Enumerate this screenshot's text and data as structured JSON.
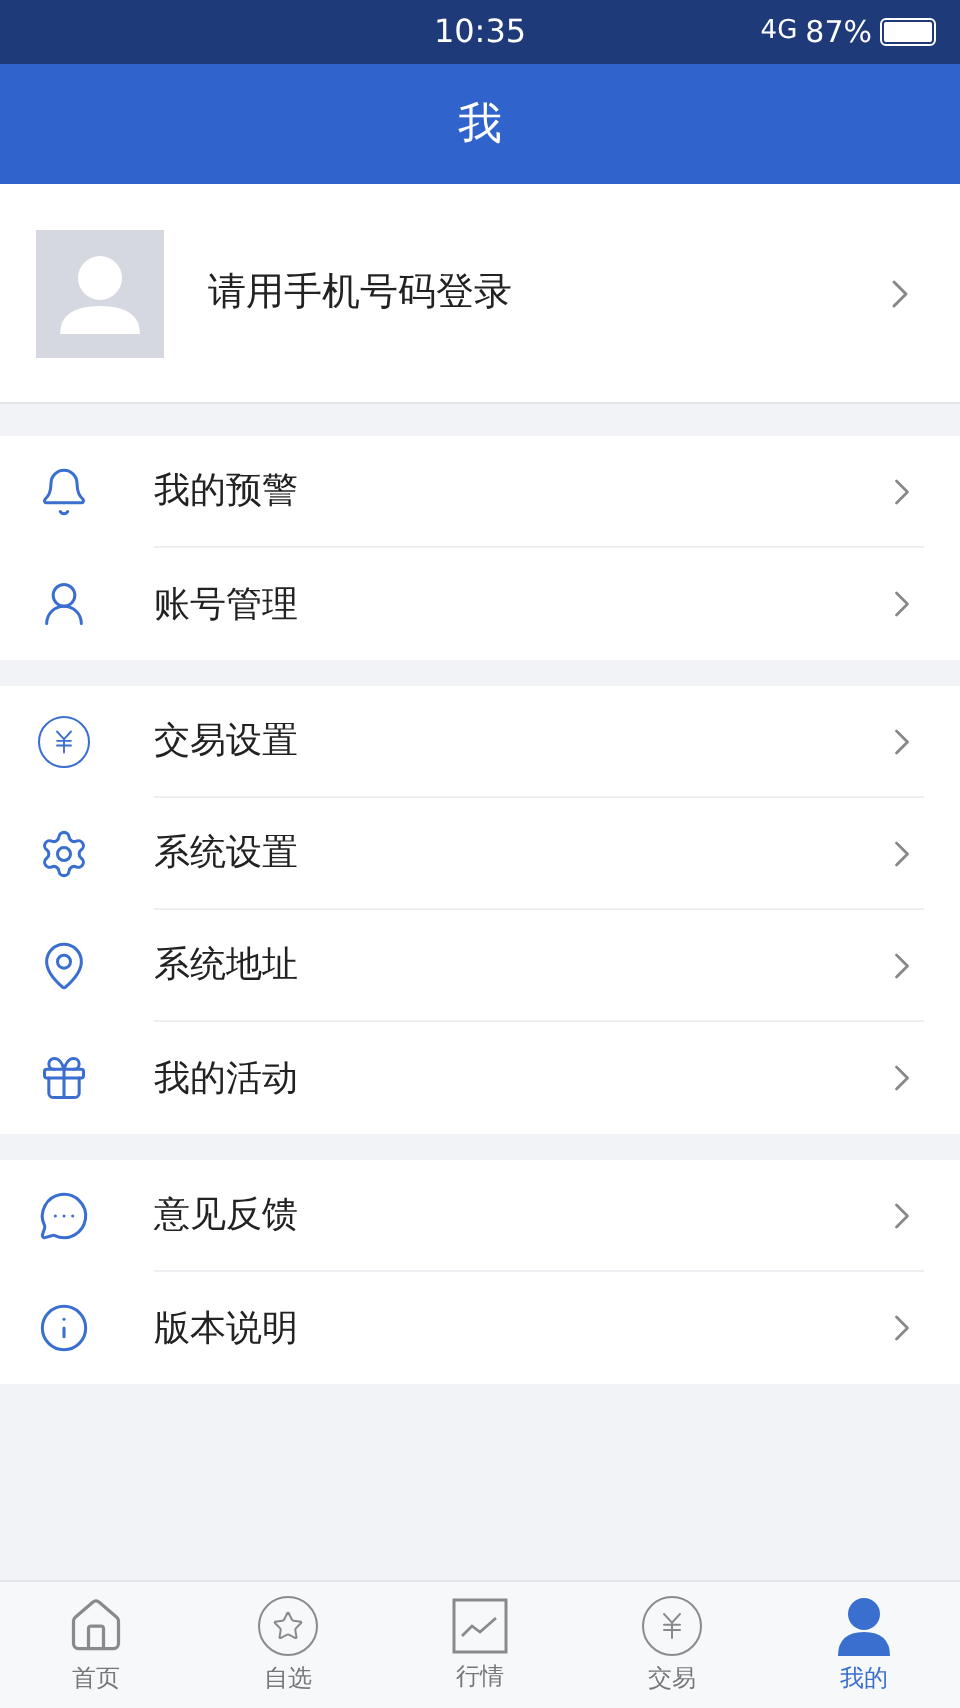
{
  "status_bar": {
    "time": "10:35",
    "network": "4G",
    "battery": "87%"
  },
  "header": {
    "title": "我"
  },
  "profile": {
    "login_text": "请用手机号码登录"
  },
  "groups": [
    {
      "items": [
        {
          "kind": "bell",
          "label": "我的预警"
        },
        {
          "kind": "account",
          "label": "账号管理"
        }
      ]
    },
    {
      "items": [
        {
          "kind": "yen",
          "label": "交易设置"
        },
        {
          "kind": "gear",
          "label": "系统设置"
        },
        {
          "kind": "pin",
          "label": "系统地址"
        },
        {
          "kind": "gift",
          "label": "我的活动"
        }
      ]
    },
    {
      "items": [
        {
          "kind": "chat",
          "label": "意见反馈"
        },
        {
          "kind": "info",
          "label": "版本说明"
        }
      ]
    }
  ],
  "tabs": [
    {
      "kind": "home",
      "label": "首页",
      "selected": false
    },
    {
      "kind": "star",
      "label": "自选",
      "selected": false
    },
    {
      "kind": "chart",
      "label": "行情",
      "selected": false
    },
    {
      "kind": "yen",
      "label": "交易",
      "selected": false
    },
    {
      "kind": "user",
      "label": "我的",
      "selected": true
    }
  ]
}
